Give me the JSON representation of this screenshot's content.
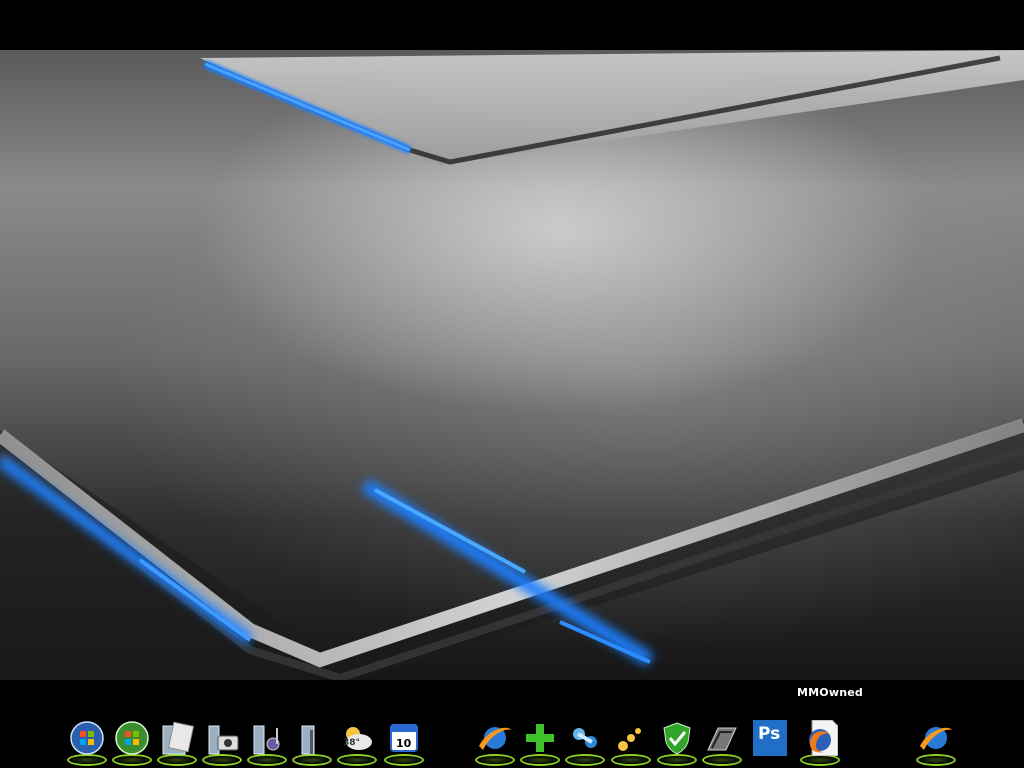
{
  "desktop": {
    "wallpaper_accent": "#1e7fff",
    "wallpaper_base": "#6a6a6a"
  },
  "dock": {
    "hover_label": "MMOwned",
    "accent_ring": "#8fd11e",
    "items": [
      {
        "icon": "windows-orb-icon"
      },
      {
        "icon": "windows-start-icon"
      },
      {
        "icon": "documents-folder-icon"
      },
      {
        "icon": "pictures-folder-icon"
      },
      {
        "icon": "music-folder-icon"
      },
      {
        "icon": "folder-icon"
      },
      {
        "icon": "weather-icon",
        "badge": "38°"
      },
      {
        "icon": "calendar-icon",
        "badge": "10"
      },
      {
        "icon": "internet-explorer-icon"
      },
      {
        "icon": "add-icon"
      },
      {
        "icon": "messenger-icon"
      },
      {
        "icon": "dots-app-icon"
      },
      {
        "icon": "security-shield-icon"
      },
      {
        "icon": "recycle-bin-icon"
      },
      {
        "icon": "photoshop-icon",
        "badge": "Ps"
      },
      {
        "icon": "firefox-icon"
      },
      {
        "icon": "internet-explorer-icon"
      }
    ]
  }
}
